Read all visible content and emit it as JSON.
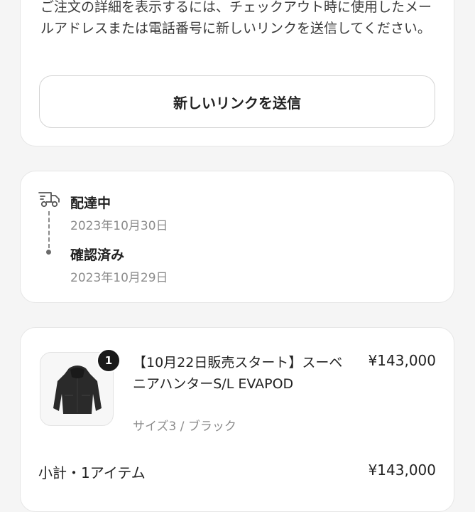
{
  "link_card": {
    "message": "ご注文の詳細を表示するには、チェックアウト時に使用したメールアドレスまたは電話番号に新しいリンクを送信してください。",
    "button_label": "新しいリンクを送信"
  },
  "status": {
    "icon": "delivery-truck-icon",
    "items": [
      {
        "title": "配達中",
        "date": "2023年10月30日"
      },
      {
        "title": "確認済み",
        "date": "2023年10月29日"
      }
    ]
  },
  "order": {
    "item": {
      "quantity": "1",
      "name": "【10月22日販売スタート】スーベニアハンターS/L EVAPOD",
      "variant": "サイズ3 / ブラック",
      "price": "¥143,000"
    },
    "subtotal_label": "小計・1アイテム",
    "subtotal_value": "¥143,000"
  }
}
